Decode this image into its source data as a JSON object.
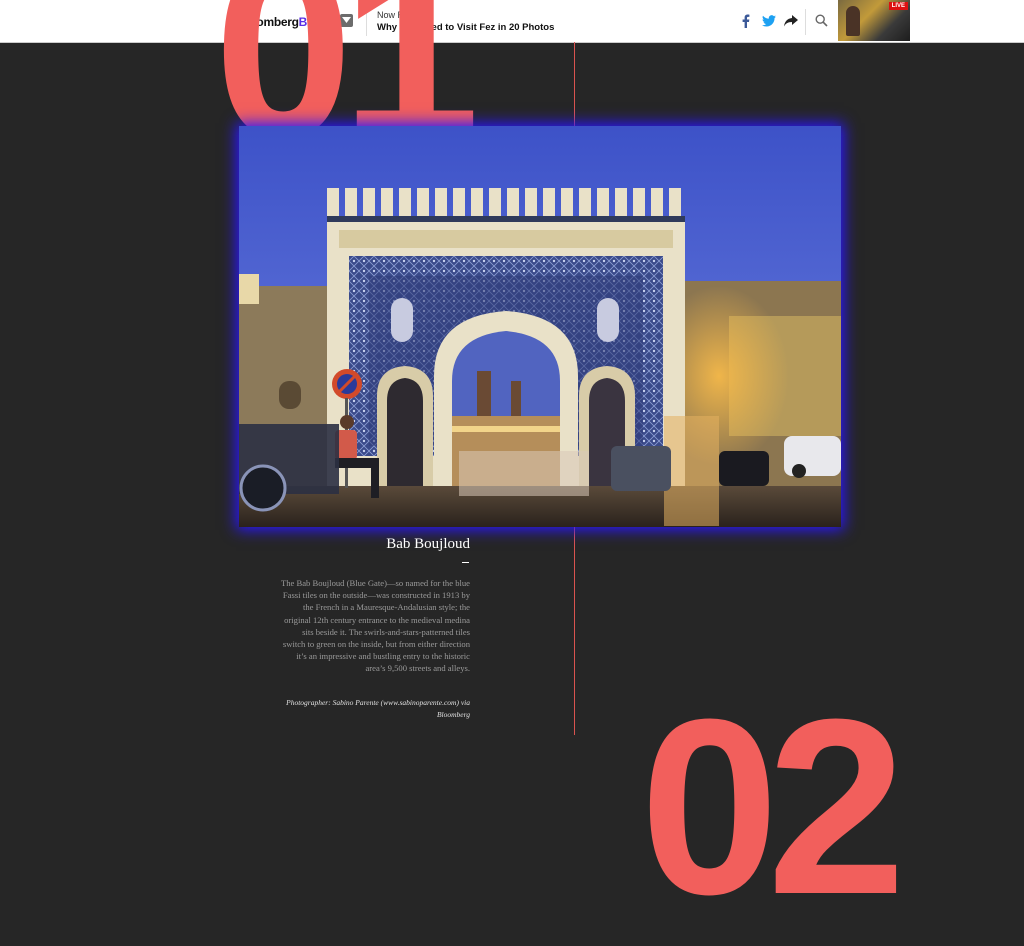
{
  "header": {
    "logo_part1": "Bloomberg",
    "logo_part2": "Business",
    "now_reading_label": "Now Reading:",
    "now_reading_title": "Why You Need to Visit Fez in 20 Photos",
    "live_badge": "LIVE"
  },
  "section": {
    "number_current": "01",
    "number_next": "02"
  },
  "photo": {
    "subject": "Bab Boujloud gate at dusk"
  },
  "caption": {
    "title": "Bab Boujloud",
    "body": "The Bab Boujloud (Blue Gate)—so named for the blue Fassi tiles on the outside—was constructed in 1913 by the French in a Mauresque-Andalusian style; the original 12th century entrance to the medieval medina sits beside it. The swirls-and-stars-patterned tiles switch to green on the inside, but from either direction it’s an impressive and bustling entry to the historic area’s 9,500 streets and alleys.",
    "credit": "Photographer: Sabino Parente (www.sabinoparente.com) via Bloomberg"
  },
  "colors": {
    "accent": "#f25f5c",
    "glow": "#2a16ff",
    "background": "#262626"
  }
}
